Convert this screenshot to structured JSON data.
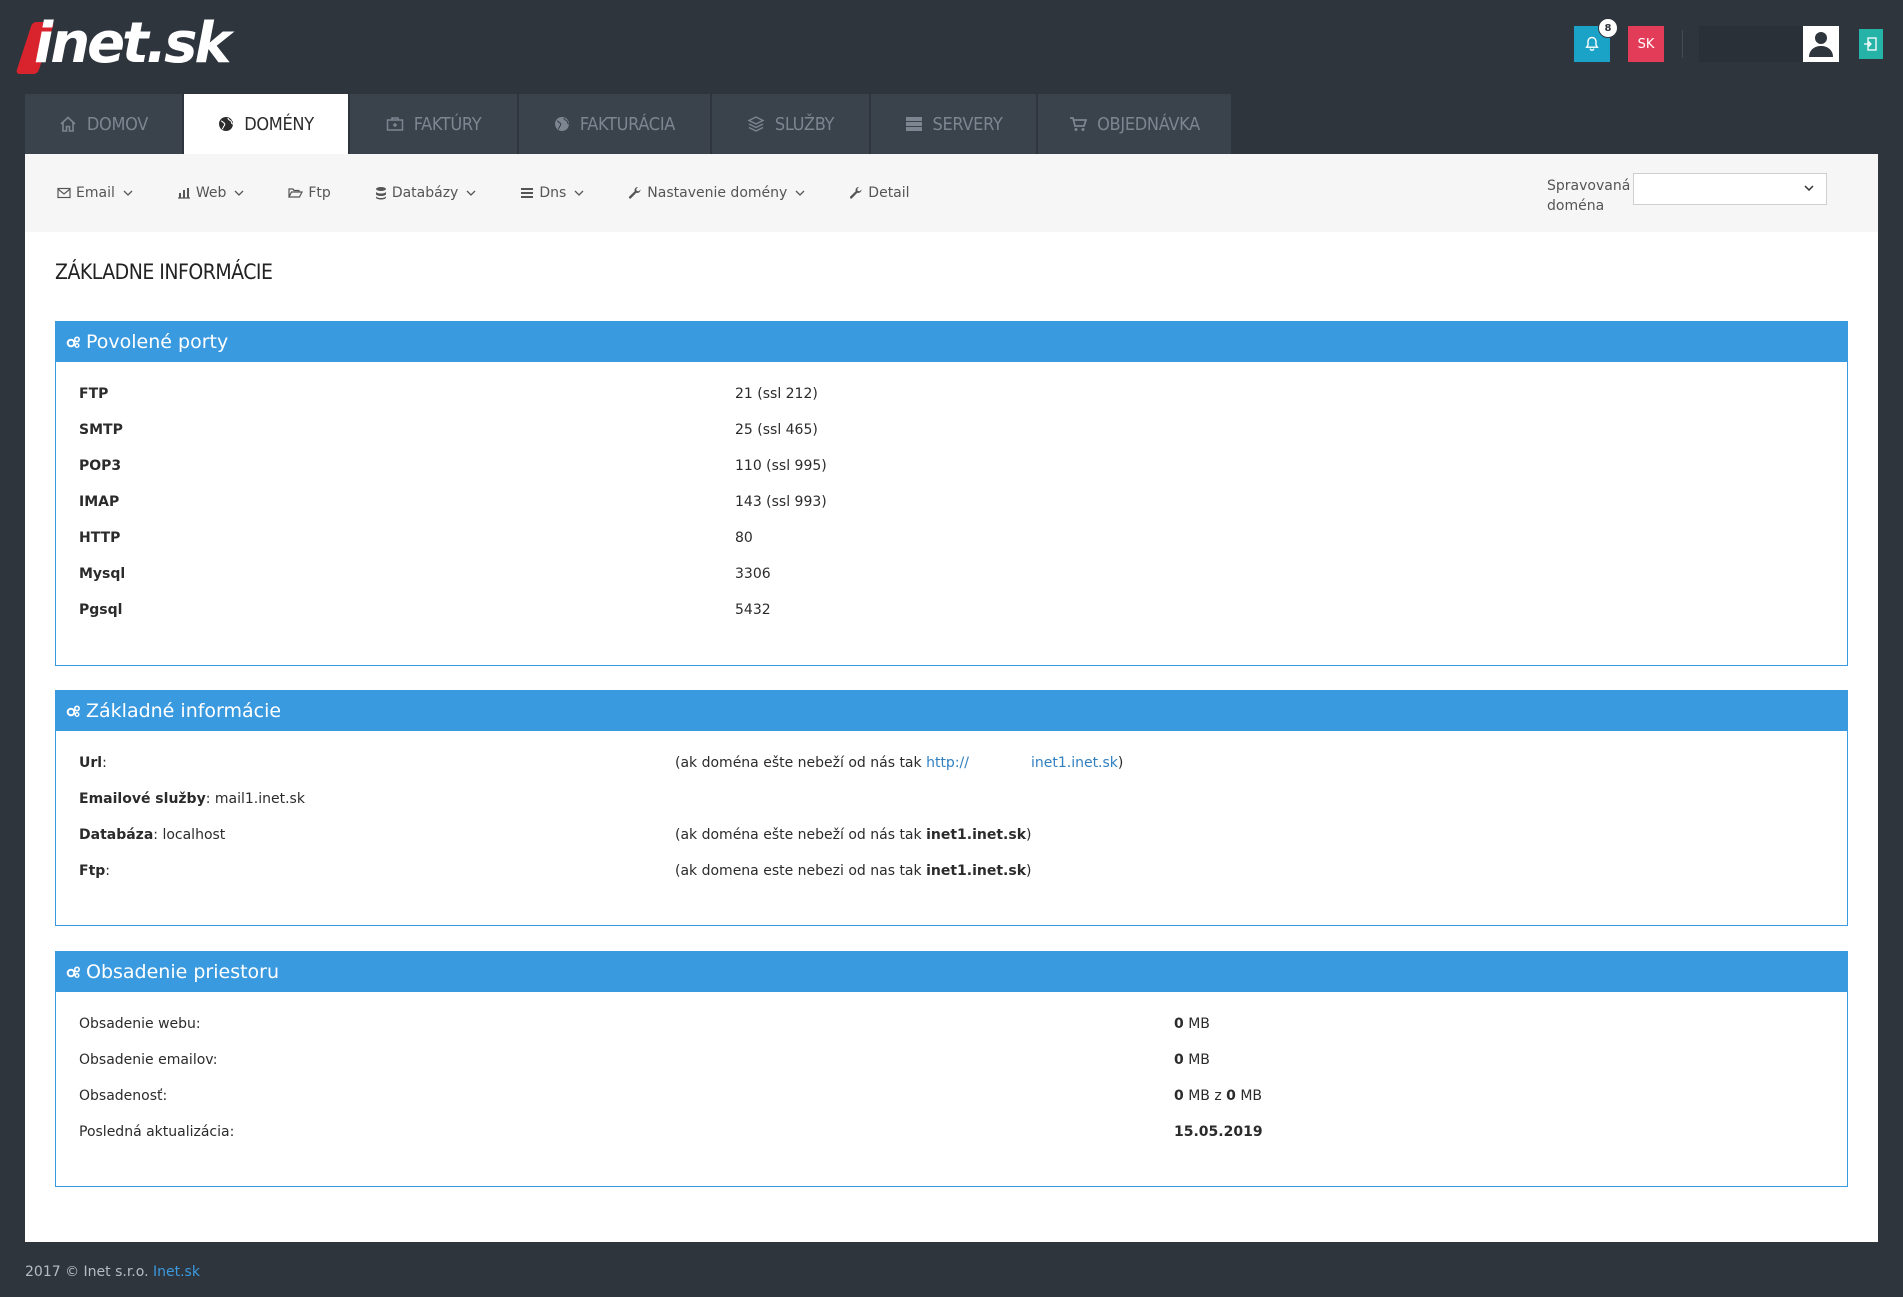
{
  "logo": {
    "text": "inet.sk",
    "brand_color": "#d9232d"
  },
  "header": {
    "notification_count": "8",
    "language": "SK",
    "icons": {
      "notifications": "bell-icon",
      "user": "user-icon",
      "logout": "logout-icon"
    }
  },
  "main_tabs": [
    {
      "label": "DOMOV",
      "icon": "home-icon",
      "active": false
    },
    {
      "label": "DOMÉNY",
      "icon": "globe-icon",
      "active": true
    },
    {
      "label": "FAKTÚRY",
      "icon": "briefcase-icon",
      "active": false
    },
    {
      "label": "FAKTURÁCIA",
      "icon": "globe-icon",
      "active": false
    },
    {
      "label": "SLUŽBY",
      "icon": "layers-icon",
      "active": false
    },
    {
      "label": "SERVERY",
      "icon": "server-icon",
      "active": false
    },
    {
      "label": "OBJEDNÁVKA",
      "icon": "cart-icon",
      "active": false
    }
  ],
  "subnav": {
    "items": [
      {
        "label": "Email",
        "icon": "envelope-icon",
        "dropdown": true
      },
      {
        "label": "Web",
        "icon": "bar-chart-icon",
        "dropdown": true
      },
      {
        "label": "Ftp",
        "icon": "folder-open-icon",
        "dropdown": false
      },
      {
        "label": "Databázy",
        "icon": "database-icon",
        "dropdown": true
      },
      {
        "label": "Dns",
        "icon": "list-icon",
        "dropdown": true
      },
      {
        "label": "Nastavenie domény",
        "icon": "wrench-icon",
        "dropdown": true
      },
      {
        "label": "Detail",
        "icon": "wrench-icon",
        "dropdown": false
      }
    ],
    "managed_domain_label_1": "Spravovaná",
    "managed_domain_label_2": "doména",
    "managed_domain_value": ""
  },
  "page_title": "ZÁKLADNE INFORMÁCIE",
  "ports_box": {
    "title": "Povolené porty",
    "rows": [
      {
        "name": "FTP",
        "value": "21 (ssl 212)"
      },
      {
        "name": "SMTP",
        "value": "25 (ssl 465)"
      },
      {
        "name": "POP3",
        "value": "110 (ssl 995)"
      },
      {
        "name": "IMAP",
        "value": "143 (ssl 993)"
      },
      {
        "name": "HTTP",
        "value": "80"
      },
      {
        "name": "Mysql",
        "value": "3306"
      },
      {
        "name": "Pgsql",
        "value": "5432"
      }
    ]
  },
  "basic_box": {
    "title": "Základné informácie",
    "url": {
      "label": "Url",
      "colon": ":",
      "note_prefix": "(ak doména ešte nebeží od nás tak ",
      "link_a": "http://",
      "link_b": "inet1.inet.sk",
      "note_suffix": ")"
    },
    "email": {
      "label": "Emailové služby",
      "colon": ":",
      "value": " mail1.inet.sk"
    },
    "db": {
      "label": "Databáza",
      "colon": ":",
      "value": " localhost",
      "note_prefix": "(ak doména ešte nebeží od nás tak ",
      "host": "inet1.inet.sk",
      "note_suffix": ")"
    },
    "ftp": {
      "label": "Ftp",
      "colon": ":",
      "note_prefix": "(ak domena este nebezi od nas tak ",
      "host": "inet1.inet.sk",
      "note_suffix": ")"
    }
  },
  "space_box": {
    "title": "Obsadenie priestoru",
    "web": {
      "label": "Obsadenie webu:",
      "value": "0",
      "unit": " MB"
    },
    "mail": {
      "label": "Obsadenie emailov:",
      "value": "0",
      "unit": " MB"
    },
    "total": {
      "label": "Obsadenosť:",
      "used": "0",
      "mid": " MB z ",
      "max": "0",
      "unit": " MB"
    },
    "updated": {
      "label": "Posledná aktualizácia:",
      "value": "15.05.2019"
    }
  },
  "footer": {
    "text": "2017 © Inet s.r.o. ",
    "link": "Inet.sk"
  }
}
